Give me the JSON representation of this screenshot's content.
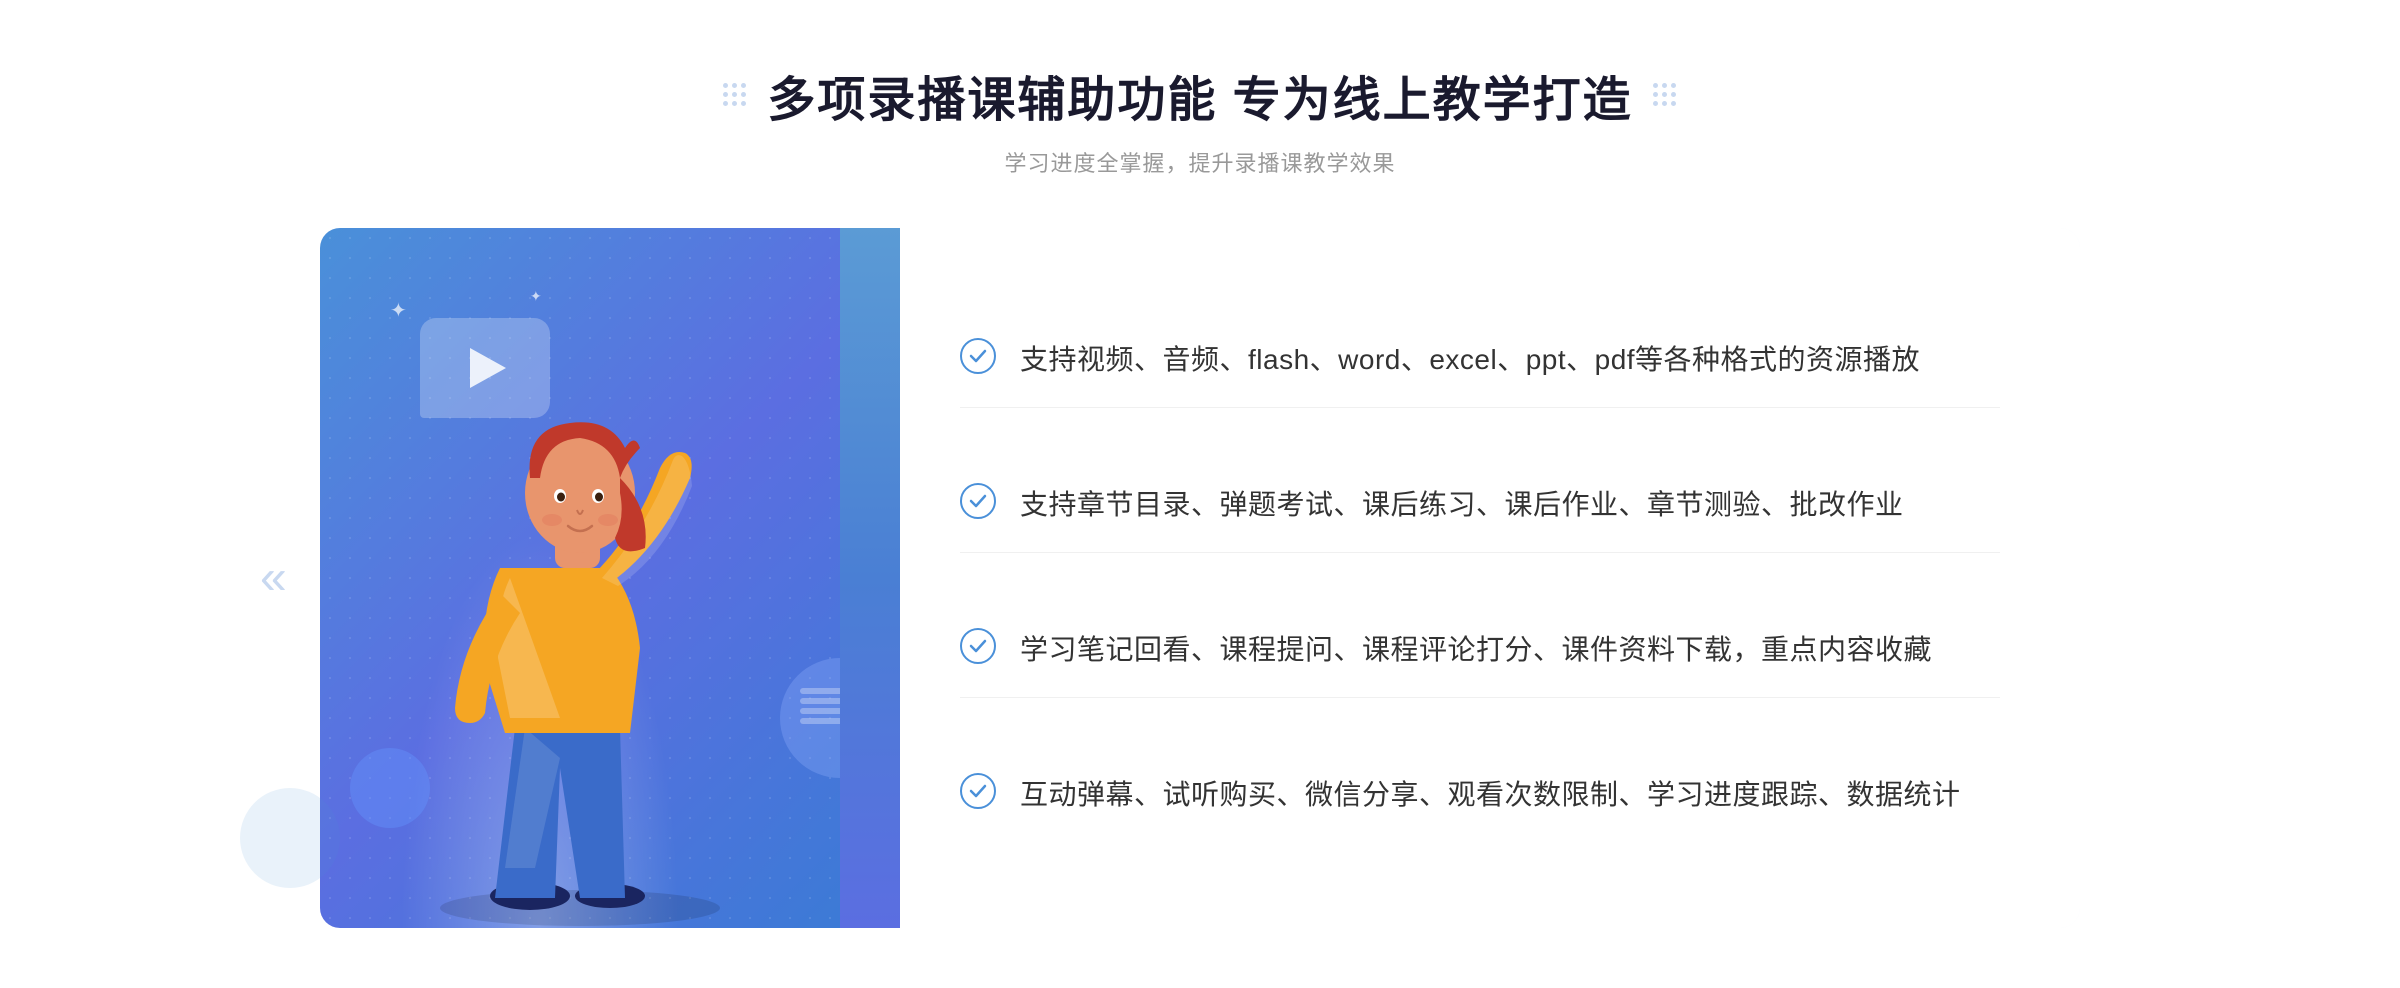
{
  "header": {
    "title": "多项录播课辅助功能 专为线上教学打造",
    "subtitle": "学习进度全掌握，提升录播课教学效果",
    "title_left_dots": "dots-left",
    "title_right_dots": "dots-right"
  },
  "features": [
    {
      "id": 1,
      "text": "支持视频、音频、flash、word、excel、ppt、pdf等各种格式的资源播放"
    },
    {
      "id": 2,
      "text": "支持章节目录、弹题考试、课后练习、课后作业、章节测验、批改作业"
    },
    {
      "id": 3,
      "text": "学习笔记回看、课程提问、课程评论打分、课件资料下载，重点内容收藏"
    },
    {
      "id": 4,
      "text": "互动弹幕、试听购买、微信分享、观看次数限制、学习进度跟踪、数据统计"
    }
  ],
  "colors": {
    "primary_blue": "#4a90d9",
    "gradient_start": "#4a90d9",
    "gradient_end": "#5b6ee1",
    "text_dark": "#1a1a2e",
    "text_gray": "#999999",
    "text_feature": "#333333",
    "bg_light": "#f5f8ff",
    "dot_color": "#c8d8f0"
  },
  "chevron": "»",
  "chevron_left": "«"
}
